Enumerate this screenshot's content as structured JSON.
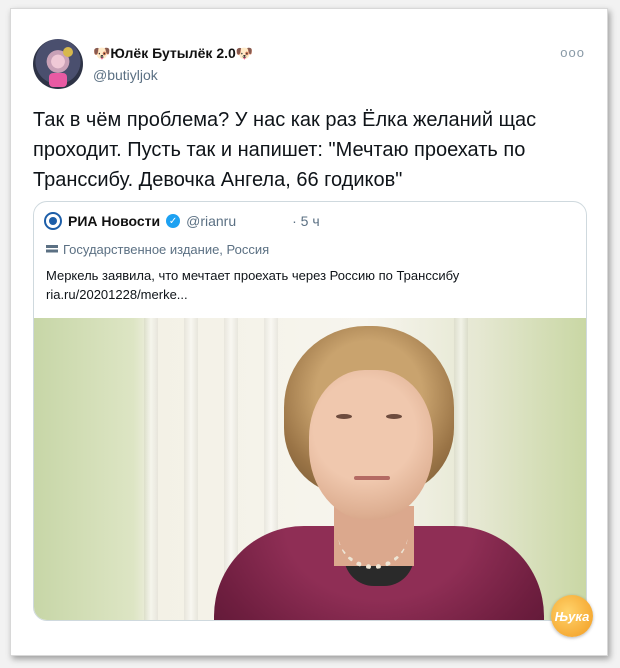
{
  "tweet": {
    "author_name": "🐶Юлёк Бутылёк 2.0🐶",
    "author_handle": "@butiyljok",
    "more_icon": "ooo",
    "text": "Так в чём проблема? У нас как раз Ёлка желаний щас проходит. Пусть так и напишет: \"Мечтаю проехать по Транссибу. Девочка Ангела, 66 годиков\""
  },
  "quoted": {
    "source_name": "РИА Новости",
    "source_handle": "@rianru",
    "time": "· 5 ч",
    "label": "Государственное издание, Россия",
    "text": "Меркель заявила, что мечтает проехать через Россию по Транссибу",
    "link": "ria.ru/20201228/merke..."
  },
  "watermark": "Њука",
  "colors": {
    "verified": "#1da1f2",
    "text_secondary": "#5b7083",
    "jacket": "#8f2e55"
  }
}
